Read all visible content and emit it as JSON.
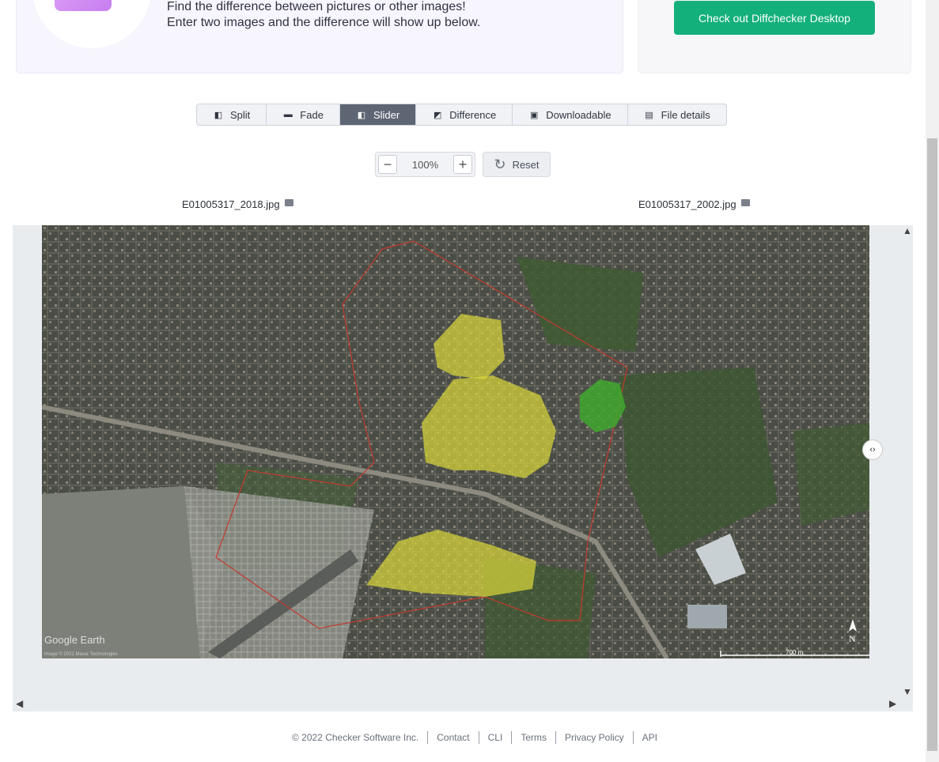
{
  "hero": {
    "line1": "Find the difference between pictures or other images!",
    "line2": "Enter two images and the difference will show up below."
  },
  "promo": {
    "button_label": "Check out Diffchecker Desktop"
  },
  "tabs": [
    {
      "label": "Split",
      "icon": "split-icon",
      "active": false
    },
    {
      "label": "Fade",
      "icon": "fade-icon",
      "active": false
    },
    {
      "label": "Slider",
      "icon": "slider-icon",
      "active": true
    },
    {
      "label": "Difference",
      "icon": "difference-icon",
      "active": false
    },
    {
      "label": "Downloadable",
      "icon": "download-icon",
      "active": false
    },
    {
      "label": "File details",
      "icon": "file-details-icon",
      "active": false
    }
  ],
  "zoom": {
    "minus": "−",
    "value": "100%",
    "plus": "+",
    "reset_label": "Reset"
  },
  "files": {
    "left": "E01005317_2018.jpg",
    "right": "E01005317_2002.jpg"
  },
  "map": {
    "watermark": "Google Earth",
    "credit": "Image © 2021 Maxar Technologies",
    "scale": "700 m",
    "north": "N"
  },
  "footer": {
    "copyright": "© 2022 Checker Software Inc.",
    "links": [
      "Contact",
      "CLI",
      "Terms",
      "Privacy Policy",
      "API"
    ]
  }
}
